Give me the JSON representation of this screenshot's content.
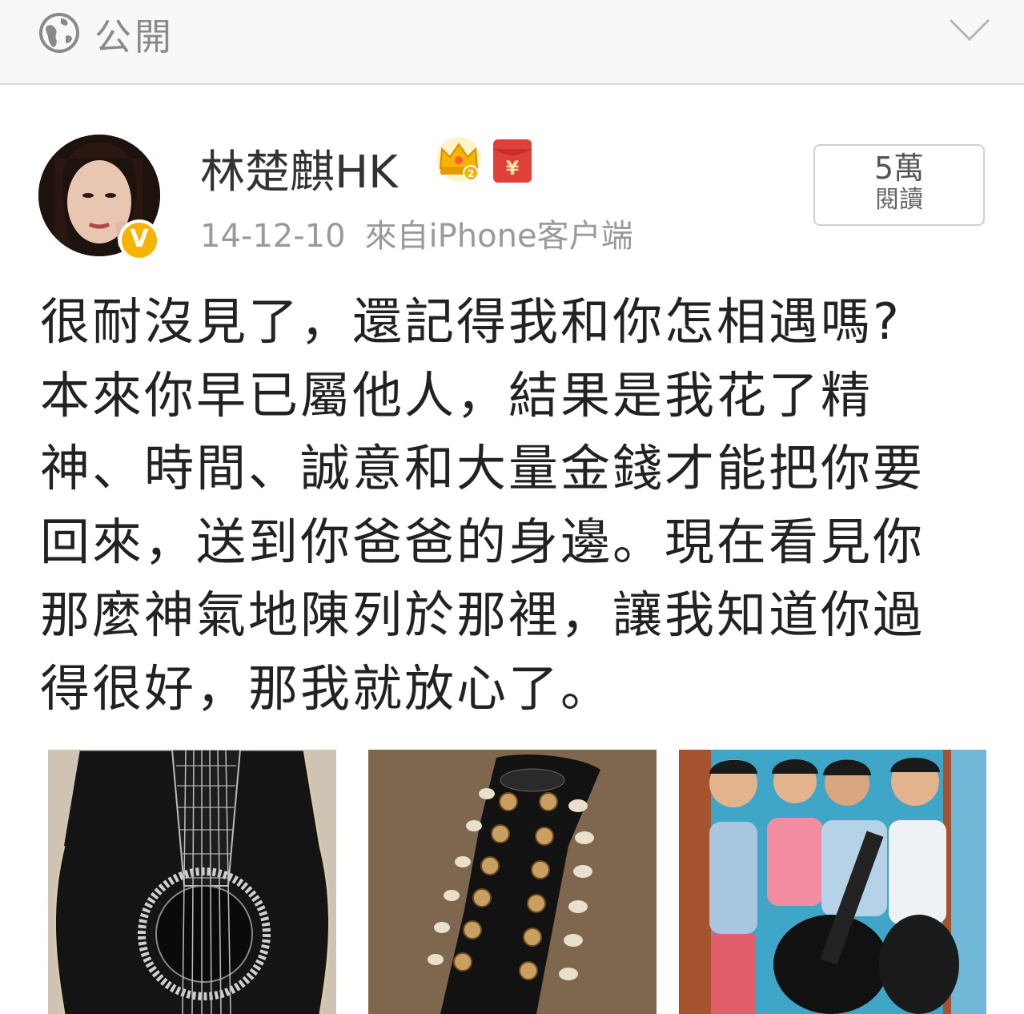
{
  "topbar": {
    "visibility_label": "公開",
    "globe_icon": "globe-icon",
    "expand_icon": "chevron-down-icon"
  },
  "post": {
    "author": "林楚麒HK",
    "verified_badge": "V",
    "date": "14-12-10",
    "source": "來自iPhone客户端",
    "reads": {
      "count": "5萬",
      "label": "閱讀"
    },
    "text_lines": [
      "很耐沒見了，還記得我和你怎相遇嗎?",
      "本來你早已屬他人，結果是我花了精",
      "神、時間、誠意和大量金錢才能把你要",
      "回來，送到你爸爸的身邊。現在看見你",
      "那麼神氣地陳列於那裡，讓我知道你過",
      "得很好，那我就放心了。"
    ],
    "photos": [
      "guitar-body-photo",
      "guitar-headstock-photo",
      "band-photo"
    ]
  },
  "colors": {
    "accent_gold": "#f6b300",
    "red_envelope": "#e0403a",
    "meta_gray": "#9a9a9a"
  }
}
